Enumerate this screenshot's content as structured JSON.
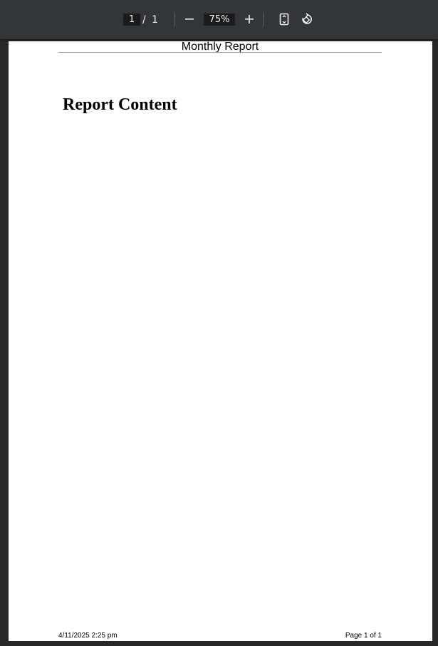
{
  "toolbar": {
    "current_page": "1",
    "page_separator": "/",
    "total_pages": "1",
    "zoom_level": "75%",
    "icons": {
      "zoom_out": "minus-icon",
      "zoom_in": "plus-icon",
      "fit": "fit-to-page-icon",
      "rotate": "rotate-icon"
    }
  },
  "document": {
    "header": "Monthly Report",
    "heading": "Report Content",
    "footer_date": "4/11/2025 2:25 pm",
    "footer_page": "Page 1 of 1"
  },
  "colors": {
    "toolbar_bg": "#323639",
    "viewer_bg": "#282828",
    "page_bg": "#ffffff"
  }
}
